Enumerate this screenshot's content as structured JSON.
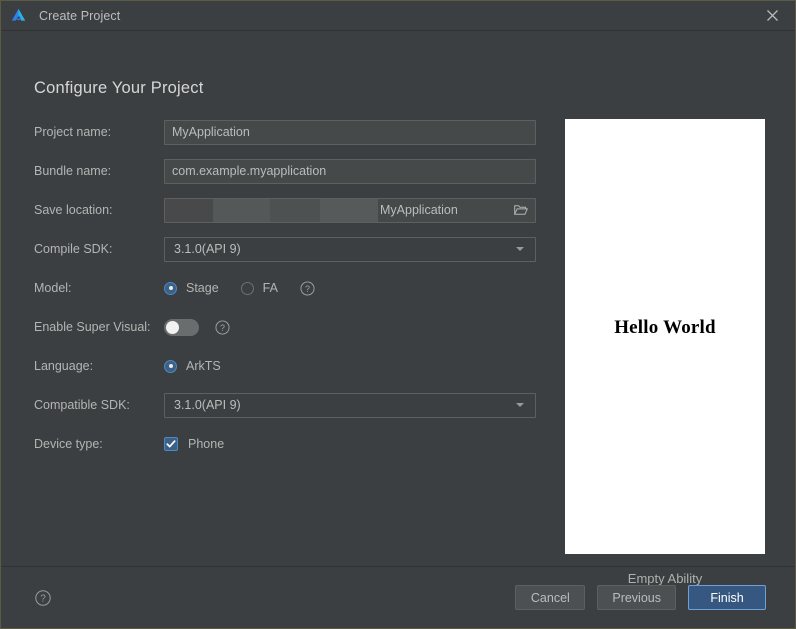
{
  "window": {
    "title": "Create Project",
    "logo_icon": "deveco-logo-icon",
    "close_icon": "close-icon"
  },
  "page": {
    "heading": "Configure Your Project"
  },
  "form": {
    "project_name": {
      "label": "Project name:",
      "value": "MyApplication"
    },
    "bundle_name": {
      "label": "Bundle name:",
      "value": "com.example.myapplication"
    },
    "save_location": {
      "label": "Save location:",
      "value": "MyApplication",
      "browse_icon": "folder-open-icon"
    },
    "compile_sdk": {
      "label": "Compile SDK:",
      "value": "3.1.0(API 9)",
      "arrow_icon": "chevron-down-icon"
    },
    "model": {
      "label": "Model:",
      "options": [
        {
          "label": "Stage",
          "selected": true
        },
        {
          "label": "FA",
          "selected": false
        }
      ],
      "help_icon": "help-circle-icon"
    },
    "enable_super_visual": {
      "label": "Enable Super Visual:",
      "state": "off",
      "help_icon": "help-circle-icon"
    },
    "language": {
      "label": "Language:",
      "options": [
        {
          "label": "ArkTS",
          "selected": true
        }
      ]
    },
    "compatible_sdk": {
      "label": "Compatible SDK:",
      "value": "3.1.0(API 9)",
      "arrow_icon": "chevron-down-icon"
    },
    "device_type": {
      "label": "Device type:",
      "options": [
        {
          "label": "Phone",
          "checked": true
        }
      ]
    }
  },
  "preview": {
    "screen_text": "Hello World",
    "caption": "Empty Ability"
  },
  "footer": {
    "help_icon": "help-circle-icon",
    "buttons": {
      "cancel": "Cancel",
      "previous": "Previous",
      "finish": "Finish"
    }
  },
  "colors": {
    "background": "#3c3f41",
    "accent": "#365880",
    "accent_border": "#6ea1d8",
    "field_background": "#45494a",
    "text": "#bbbbbb",
    "logo_blue": "#2f80ed",
    "logo_cyan": "#29b6d8"
  }
}
